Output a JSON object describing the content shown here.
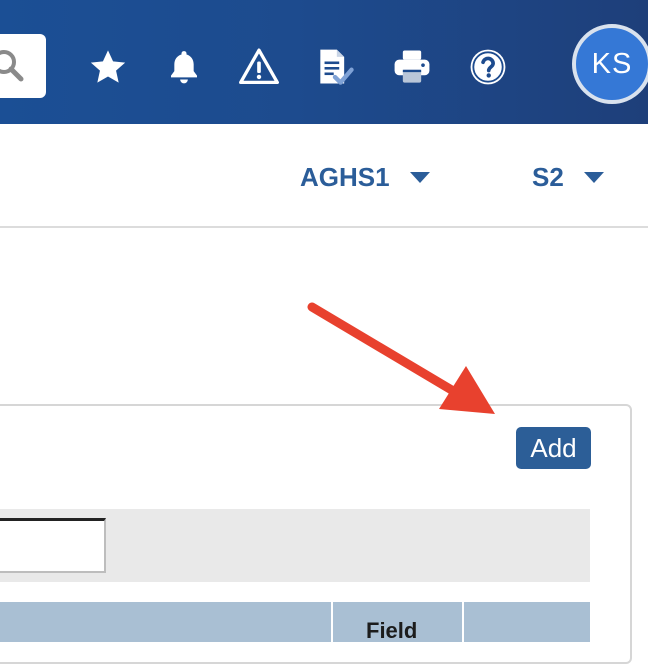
{
  "header": {
    "icons": [
      "search-icon",
      "star-icon",
      "bell-icon",
      "warning-icon",
      "document-check-icon",
      "print-icon",
      "help-icon"
    ],
    "avatar_initials": "KS",
    "colors": {
      "bar": "#1d4b8e",
      "avatar": "#3578d6"
    }
  },
  "selectors": {
    "school": "AGHS1",
    "term": "S2"
  },
  "panel": {
    "add_label": "Add",
    "filter_value": "",
    "table_header_partial": "Field"
  },
  "annotation": {
    "arrow_color": "#e8412e",
    "points_to": "add-button"
  }
}
